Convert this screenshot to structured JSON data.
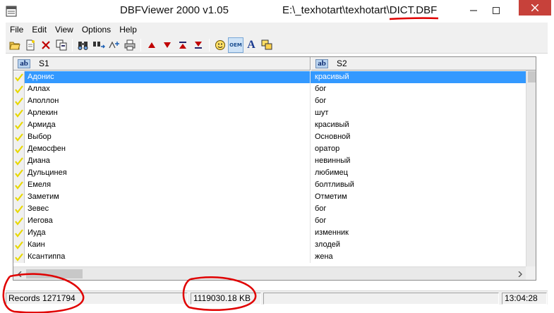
{
  "window": {
    "app_title": "DBFViewer 2000 v1.05",
    "file_path_prefix": "E:\\_texhotart\\texhotart\\",
    "file_name": "DICT.DBF",
    "controls": {
      "minimize": "minimize-icon",
      "maximize": "maximize-icon",
      "close": "close-icon"
    }
  },
  "menu": [
    "File",
    "Edit",
    "View",
    "Options",
    "Help"
  ],
  "toolbar_icons": [
    "open-icon",
    "new-icon",
    "delete-icon",
    "copy-icon",
    "find-icon",
    "replace-icon",
    "filter-icon",
    "print-icon",
    "arrow-up-icon",
    "arrow-down-icon",
    "move-top-icon",
    "move-bottom-icon",
    "smiley-icon",
    "oem-icon",
    "font-icon",
    "window-icon"
  ],
  "toolbar_oem_label": "OEM",
  "toolbar_font_label": "A",
  "columns": [
    {
      "type_badge": "ab",
      "name": "S1"
    },
    {
      "type_badge": "ab",
      "name": "S2"
    }
  ],
  "rows": [
    {
      "s1": "Адонис",
      "s2": "красивый",
      "selected": true
    },
    {
      "s1": "Аллах",
      "s2": "бог"
    },
    {
      "s1": "Аполлон",
      "s2": "бог"
    },
    {
      "s1": "Арлекин",
      "s2": "шут"
    },
    {
      "s1": "Армида",
      "s2": "красивый"
    },
    {
      "s1": "Выбор",
      "s2": "Основной"
    },
    {
      "s1": "Демосфен",
      "s2": "оратор"
    },
    {
      "s1": "Диана",
      "s2": "невинный"
    },
    {
      "s1": "Дульцинея",
      "s2": "любимец"
    },
    {
      "s1": "Емеля",
      "s2": "болтливый"
    },
    {
      "s1": "Заметим",
      "s2": "Отметим"
    },
    {
      "s1": "Зевес",
      "s2": "бог"
    },
    {
      "s1": "Иегова",
      "s2": "бог"
    },
    {
      "s1": "Иуда",
      "s2": "изменник"
    },
    {
      "s1": "Каин",
      "s2": "злодей"
    },
    {
      "s1": "Ксантиппа",
      "s2": "жена"
    }
  ],
  "status": {
    "records": "Records 1271794",
    "size": "1119030.18 KB",
    "middle": "",
    "time": "13:04:28"
  },
  "colors": {
    "selection": "#3399ff",
    "close_button": "#c7413a",
    "annotation": "#e00000",
    "check": "#e8d800"
  }
}
